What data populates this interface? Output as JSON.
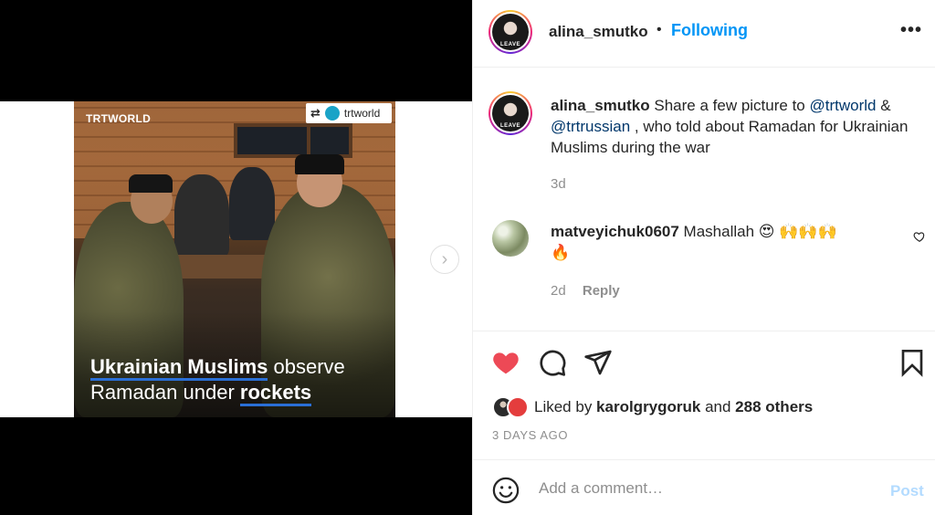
{
  "post": {
    "media": {
      "brand_logo": "TRTWORLD",
      "repost_icon": "repost-icon",
      "repost_account": "trtworld",
      "headline": {
        "line1_bold": "Ukrainian Muslims",
        "line1_rest": " observe",
        "line2_plain": "Ramadan under ",
        "line2_bold": "rockets"
      },
      "next_icon": "chevron-right-icon"
    },
    "header": {
      "username": "alina_smutko",
      "separator": "•",
      "follow_status": "Following",
      "more_icon": "more-options-icon",
      "more_glyph": "•••",
      "avatar_text": "LEAVE"
    },
    "caption": {
      "username": "alina_smutko",
      "text_1": " Share a few picture to ",
      "mention_1": "@trtworld",
      "text_2": " & ",
      "mention_2": "@trtrussian",
      "text_3": " , who told about Ramadan for Ukrainian Muslims during the war",
      "timestamp": "3d"
    },
    "comments": [
      {
        "username": "matveyichuk0607",
        "text": " Mashallah 😍 🙌🙌🙌",
        "text_line2": "🔥",
        "timestamp": "2d",
        "reply_label": "Reply"
      }
    ],
    "actions": {
      "like_icon": "heart-filled-icon",
      "comment_icon": "comment-icon",
      "share_icon": "send-icon",
      "save_icon": "bookmark-icon"
    },
    "likes": {
      "prefix": "Liked by ",
      "user": "karolgrygoruk",
      "middle": " and ",
      "others": "288 others"
    },
    "posted_ago": "3 DAYS AGO",
    "add_comment": {
      "emoji_icon": "emoji-icon",
      "placeholder": "Add a comment…",
      "post_label": "Post"
    }
  },
  "colors": {
    "accent": "#0095f6",
    "mention": "#00376b",
    "like": "#ed4956",
    "muted": "#8e8e8e",
    "post_disabled": "#b3dbff"
  }
}
